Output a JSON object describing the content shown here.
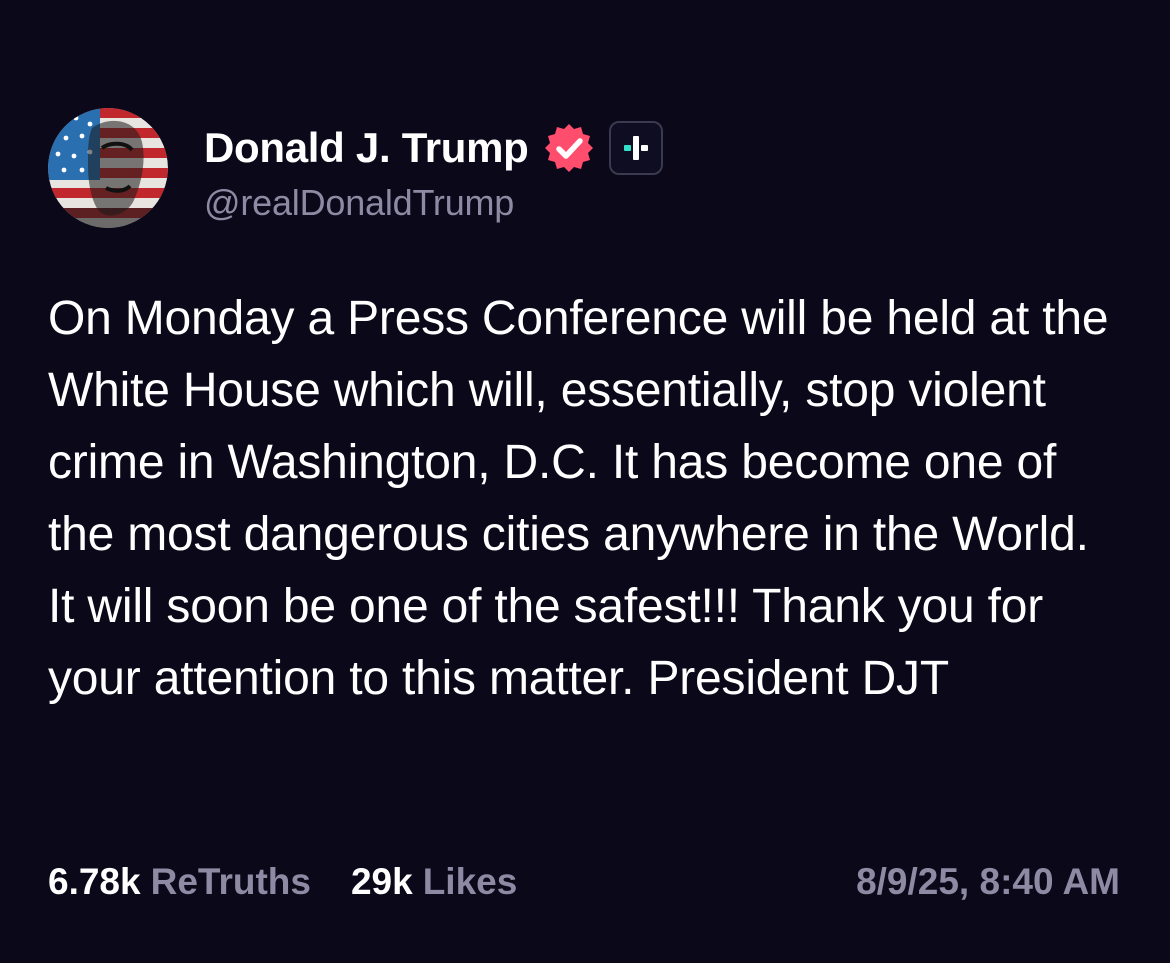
{
  "post": {
    "author": {
      "display_name": "Donald J. Trump",
      "handle": "@realDonaldTrump",
      "verified": true,
      "avatar_icon": "flag-painted-portrait-avatar",
      "verified_icon": "verified-check-badge-icon",
      "plus_icon": "follow-plus-icon"
    },
    "text": "On Monday a Press Conference will be held at the White House which will, essentially, stop violent crime in Washington, D.C. It has become one of the most dangerous cities anywhere in the World. It will soon be one of the safest!!! Thank you for your attention to this matter. President DJT",
    "stats": {
      "retruths_count": "6.78k",
      "retruths_label": "ReTruths",
      "likes_count": "29k",
      "likes_label": "Likes"
    },
    "timestamp": "8/9/25, 8:40 AM"
  },
  "colors": {
    "background": "#0b0819",
    "text_primary": "#ffffff",
    "text_secondary": "#8f8aa3",
    "verified_badge": "#ff4d6d",
    "plus_accent": "#33e0c9"
  }
}
